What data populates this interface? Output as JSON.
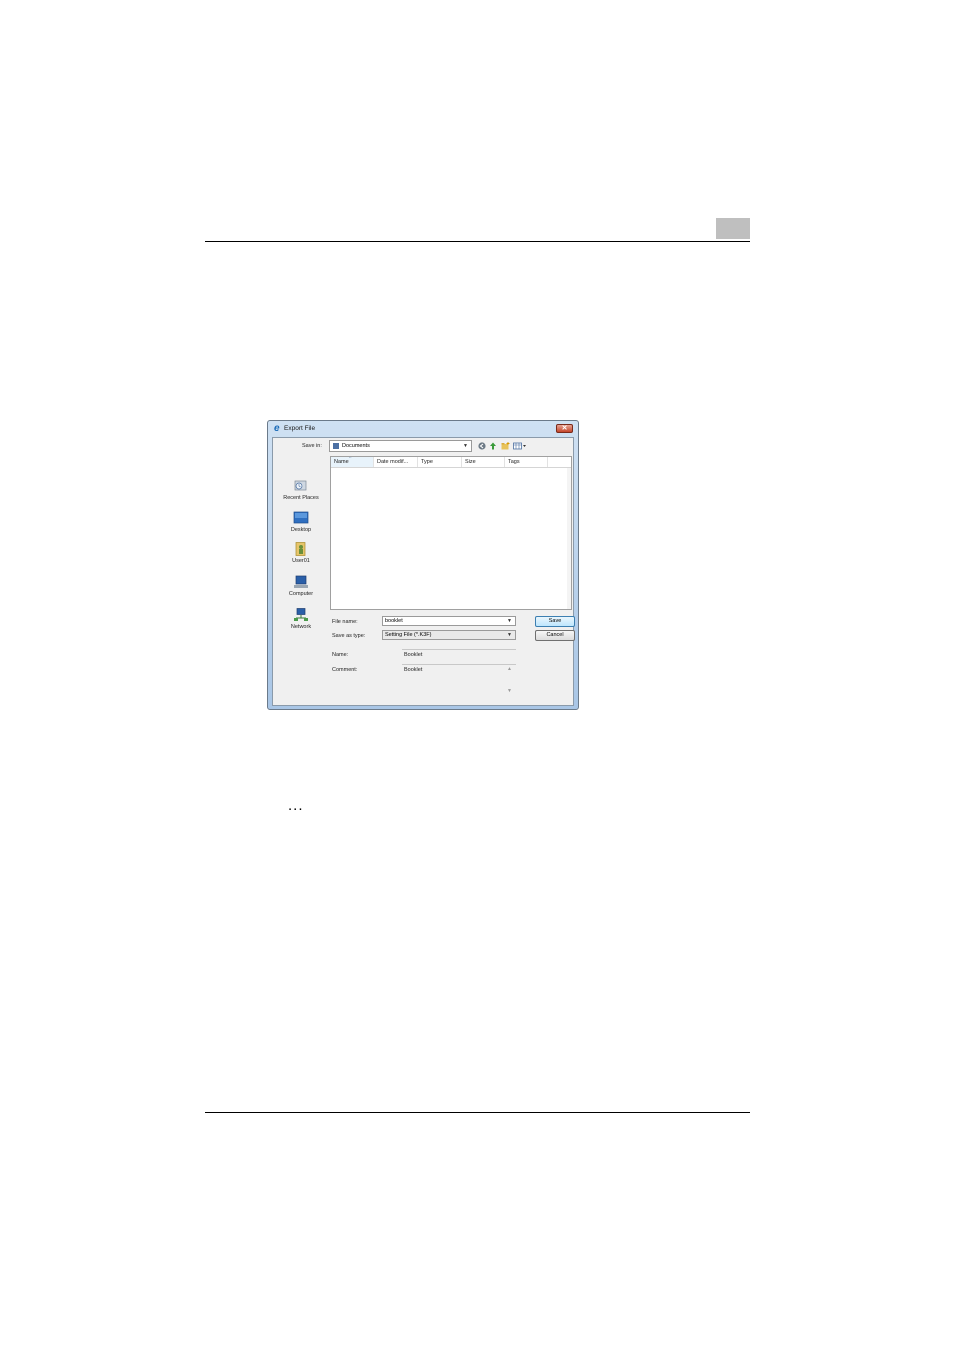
{
  "page": {
    "ellipsis": "..."
  },
  "dialog": {
    "title": "Export File",
    "close_glyph": "✕",
    "save_in": {
      "label": "Save in:",
      "value": "Documents"
    },
    "toolbar": {
      "back_icon": "back-arrow-icon",
      "up_icon": "up-folder-icon",
      "new_folder_icon": "new-folder-icon",
      "views_icon": "views-menu-icon"
    },
    "places": [
      {
        "label": "Recent Places",
        "icon": "recent-places-icon"
      },
      {
        "label": "Desktop",
        "icon": "desktop-icon"
      },
      {
        "label": "User01",
        "icon": "user-folder-icon"
      },
      {
        "label": "Computer",
        "icon": "computer-icon"
      },
      {
        "label": "Network",
        "icon": "network-icon"
      }
    ],
    "columns": [
      "Name",
      "Date modif...",
      "Type",
      "Size",
      "Tags"
    ],
    "file_name": {
      "label": "File name:",
      "value": "booklet"
    },
    "save_as_type": {
      "label": "Save as type:",
      "value": "Setting File (*.K3F)"
    },
    "buttons": {
      "save": "Save",
      "cancel": "Cancel"
    },
    "name": {
      "label": "Name:",
      "value": "Booklet"
    },
    "comment": {
      "label": "Comment:",
      "value": "Booklet"
    },
    "colors": {
      "title_gradient_top": "#cfe1f3",
      "title_gradient_bottom": "#a9c6e6",
      "close_red": "#c4452a"
    }
  }
}
